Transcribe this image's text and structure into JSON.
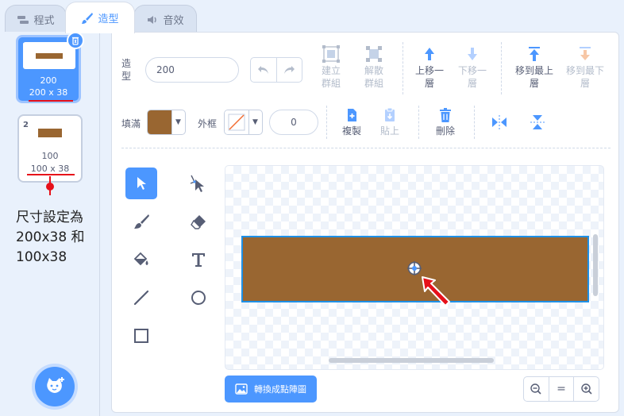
{
  "tabs": [
    {
      "label": "程式",
      "icon": "code-icon"
    },
    {
      "label": "造型",
      "icon": "brush-icon"
    },
    {
      "label": "音效",
      "icon": "speaker-icon"
    }
  ],
  "costumes": [
    {
      "number": "1",
      "name": "200",
      "size": "200 x 38",
      "selected": true
    },
    {
      "number": "2",
      "name": "100",
      "size": "100 x 38",
      "selected": false
    }
  ],
  "annotation": {
    "lines": [
      "尺寸設定為",
      "200x38 和",
      "100x38"
    ]
  },
  "editor": {
    "costume_label": "造型",
    "costume_name": "200",
    "toolbar": {
      "group": "建立群組",
      "ungroup": "解散群組",
      "forward": "上移一層",
      "backward": "下移一層",
      "front": "移到最上層",
      "back": "移到最下層"
    },
    "fill_label": "填滿",
    "outline_label": "外框",
    "outline_width": "0",
    "copy": "複製",
    "paste": "貼上",
    "delete": "刪除",
    "fill_color": "#996631",
    "convert_button": "轉換成點陣圖",
    "zoom_reset": "="
  },
  "colors": {
    "accent": "#4c97ff",
    "shape_fill": "#996631",
    "annotation": "#e6101a"
  }
}
